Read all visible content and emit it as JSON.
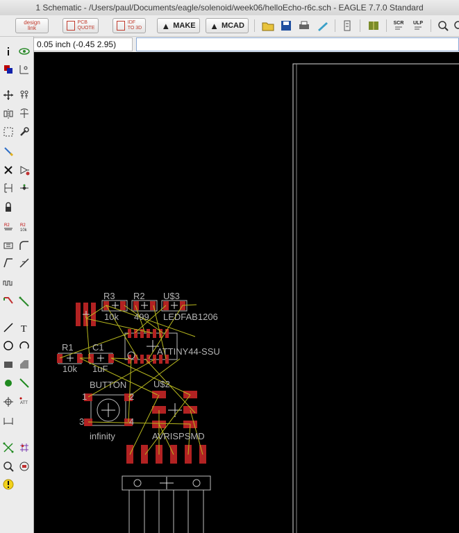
{
  "window": {
    "title": "1 Schematic - /Users/paul/Documents/eagle/solenoid/week06/helloEcho-r6c.sch - EAGLE 7.7.0 Standard"
  },
  "toolbar": {
    "design_link": {
      "top": "design",
      "bottom": "link"
    },
    "pcb_quote": {
      "top": "PCB",
      "bottom": "QUOTE"
    },
    "idf": {
      "top": "IDF",
      "bottom": "TO 3D"
    },
    "make_label": "MAKE",
    "mcad_label": "MCAD",
    "scr_label": "SCR",
    "ulp_label": "ULP"
  },
  "command": {
    "coordinate_display": "0.05 inch (-0.45 2.95)",
    "input_value": ""
  },
  "palette": {
    "value_icon_text": "10k",
    "text_tool_glyph": "T",
    "attribute_icon_text": "ATT"
  },
  "schematic": {
    "components": [
      {
        "ref": "R3",
        "value": "10k"
      },
      {
        "ref": "R2",
        "value": "499"
      },
      {
        "ref": "U$3",
        "value": "LEDFAB1206"
      },
      {
        "ref": "R1",
        "value": "10k"
      },
      {
        "ref": "C1",
        "value": "1uF"
      },
      {
        "ref": "",
        "value": "ATTINY44-SSU"
      },
      {
        "ref": "BUTTON",
        "value": "infinity"
      },
      {
        "ref": "U$2",
        "value": "AVRISPSMD"
      }
    ],
    "button_pins": [
      "1",
      "2",
      "3",
      "4"
    ]
  },
  "colors": {
    "canvas": "#000000",
    "pad": "#b22222",
    "wire": "#b8b81e",
    "outline": "#bdbdbd",
    "frame": "#dcdcdc"
  }
}
